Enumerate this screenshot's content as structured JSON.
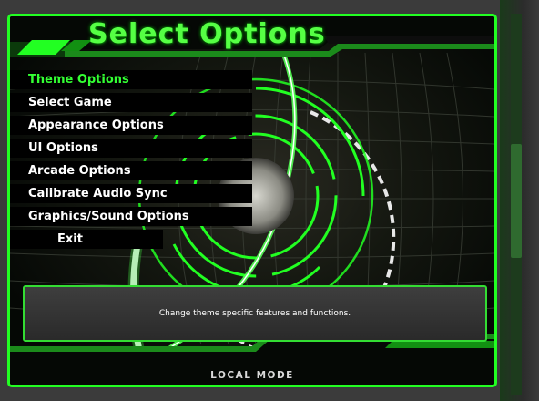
{
  "title": "Select Options",
  "menu": {
    "items": [
      {
        "label": "Theme Options",
        "selected": true
      },
      {
        "label": "Select Game",
        "selected": false
      },
      {
        "label": "Appearance Options",
        "selected": false
      },
      {
        "label": "UI Options",
        "selected": false
      },
      {
        "label": "Arcade Options",
        "selected": false
      },
      {
        "label": "Calibrate Audio Sync",
        "selected": false
      },
      {
        "label": "Graphics/Sound Options",
        "selected": false
      },
      {
        "label": "Exit",
        "selected": false
      }
    ]
  },
  "description": "Change theme specific features and functions.",
  "mode": "LOCAL MODE",
  "colors": {
    "accent": "#22ff22",
    "title": "#55ff44",
    "selected_item": "#33ff33",
    "menu_bg": "#000000",
    "text": "#ffffff"
  }
}
